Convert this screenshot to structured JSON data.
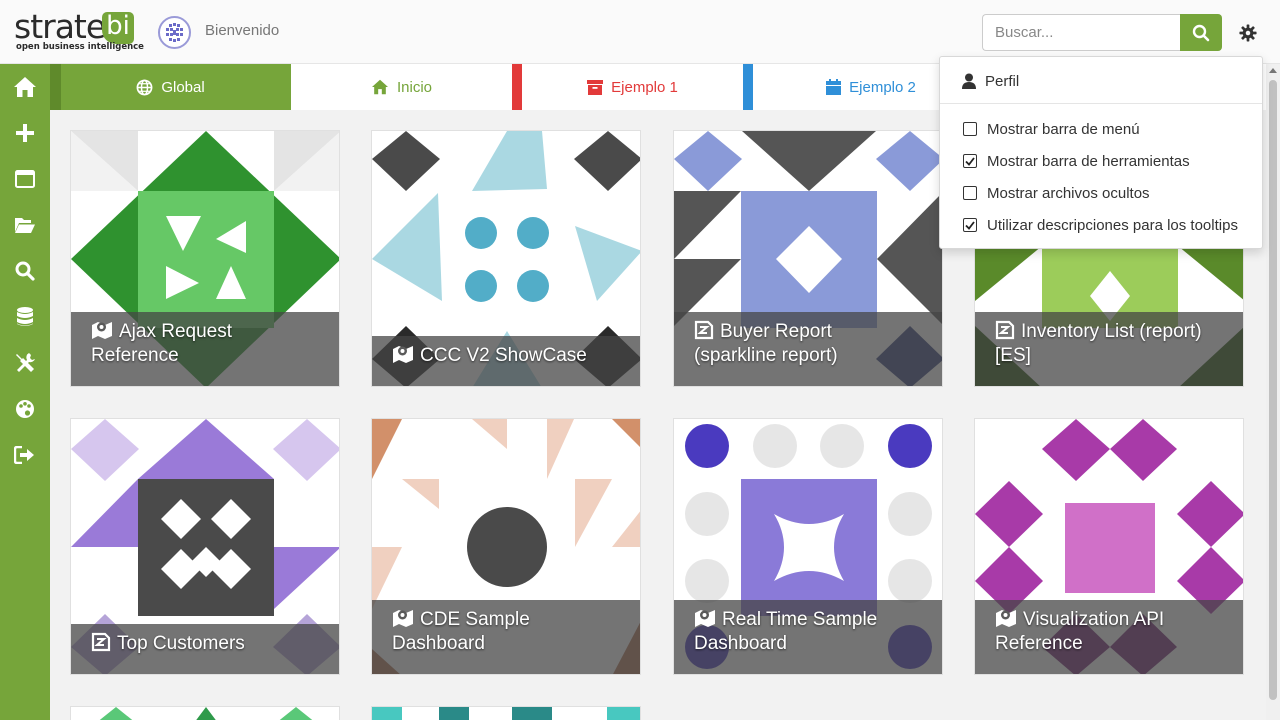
{
  "header": {
    "logo_text": "strate",
    "logo_bi": "bi",
    "logo_tagline": "open business intelligence",
    "welcome": "Bienvenido",
    "search_placeholder": "Buscar..."
  },
  "sidebar": {
    "items": [
      "home-icon",
      "plus-icon",
      "window-icon",
      "folder-open-icon",
      "search-icon",
      "database-icon",
      "tools-icon",
      "palette-icon",
      "logout-icon"
    ]
  },
  "tabs": [
    {
      "label": "Global",
      "icon": "globe-icon",
      "color": "#ffffff",
      "active": true
    },
    {
      "label": "Inicio",
      "icon": "home-icon",
      "color": "#76a53a",
      "active": false
    },
    {
      "label": "Ejemplo 1",
      "icon": "archive-icon",
      "color": "#e23a3a",
      "active": false
    },
    {
      "label": "Ejemplo 2",
      "icon": "calendar-icon",
      "color": "#2f8fd8",
      "active": false
    }
  ],
  "cards": [
    {
      "title": "Ajax Request Reference",
      "icon": "map-icon",
      "lines": [
        "Ajax Request",
        "Reference"
      ]
    },
    {
      "title": "CCC V2 ShowCase",
      "icon": "map-icon",
      "lines": [
        "CCC V2 ShowCase"
      ]
    },
    {
      "title": "Buyer Report (sparkline report)",
      "icon": "report-icon",
      "lines": [
        "Buyer Report",
        "(sparkline report)"
      ]
    },
    {
      "title": "Inventory List (report) [ES]",
      "icon": "report-icon",
      "lines": [
        "Inventory List (report)",
        "[ES]"
      ]
    },
    {
      "title": "Top Customers",
      "icon": "report-icon",
      "lines": [
        "Top Customers"
      ]
    },
    {
      "title": "CDE Sample Dashboard",
      "icon": "map-icon",
      "lines": [
        "CDE Sample",
        "Dashboard"
      ]
    },
    {
      "title": "Real Time Sample Dashboard",
      "icon": "map-icon",
      "lines": [
        "Real Time Sample",
        "Dashboard"
      ]
    },
    {
      "title": "Visualization API Reference",
      "icon": "map-icon",
      "lines": [
        "Visualization API",
        "Reference"
      ]
    }
  ],
  "dropdown": {
    "profile": "Perfil",
    "options": [
      {
        "label": "Mostrar barra de menú",
        "checked": false
      },
      {
        "label": "Mostrar barra de herramientas",
        "checked": true
      },
      {
        "label": "Mostrar archivos ocultos",
        "checked": false
      },
      {
        "label": "Utilizar descripciones para los tooltips",
        "checked": true
      }
    ]
  },
  "colors": {
    "accent": "#76a53a",
    "tab_red": "#e23a3a",
    "tab_blue": "#2f8fd8"
  }
}
